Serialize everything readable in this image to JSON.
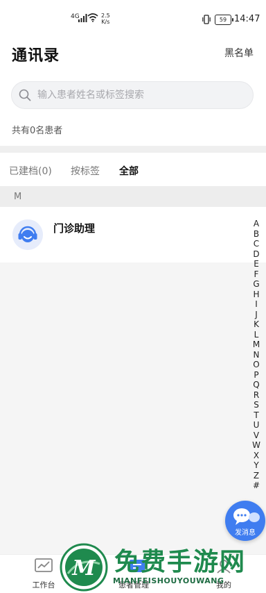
{
  "status_bar": {
    "network": "4G",
    "speed_value": "2.5",
    "speed_unit": "K/s",
    "battery": "59",
    "time": "14:47"
  },
  "header": {
    "title": "通讯录",
    "blacklist_label": "黑名单"
  },
  "search": {
    "placeholder": "输入患者姓名或标签搜索",
    "value": ""
  },
  "patient_count": "共有0名患者",
  "tabs": [
    {
      "label": "已建档(0)",
      "active": false
    },
    {
      "label": "按标签",
      "active": false
    },
    {
      "label": "全部",
      "active": true
    }
  ],
  "section_letter": "M",
  "contacts": [
    {
      "name": "门诊助理",
      "icon": "assistant-avatar-icon"
    }
  ],
  "alpha_index": [
    "A",
    "B",
    "C",
    "D",
    "E",
    "F",
    "G",
    "H",
    "I",
    "J",
    "K",
    "L",
    "M",
    "N",
    "O",
    "P",
    "Q",
    "R",
    "S",
    "T",
    "U",
    "V",
    "W",
    "X",
    "Y",
    "Z",
    "#"
  ],
  "fab": {
    "label": "发消息",
    "icon": "chat-bubbles-icon"
  },
  "bottom_nav": [
    {
      "label": "工作台",
      "icon": "chart-icon"
    },
    {
      "label": "患者管理",
      "icon": "patient-card-icon"
    },
    {
      "label": "我的",
      "icon": "profile-icon"
    }
  ],
  "watermark": {
    "title": "免费手游网",
    "subtitle": "MIANFEISHOUYOUWANG",
    "logo_letter": "M"
  },
  "colors": {
    "accent": "#3f7df0",
    "watermark_green": "#1f8a4e"
  }
}
